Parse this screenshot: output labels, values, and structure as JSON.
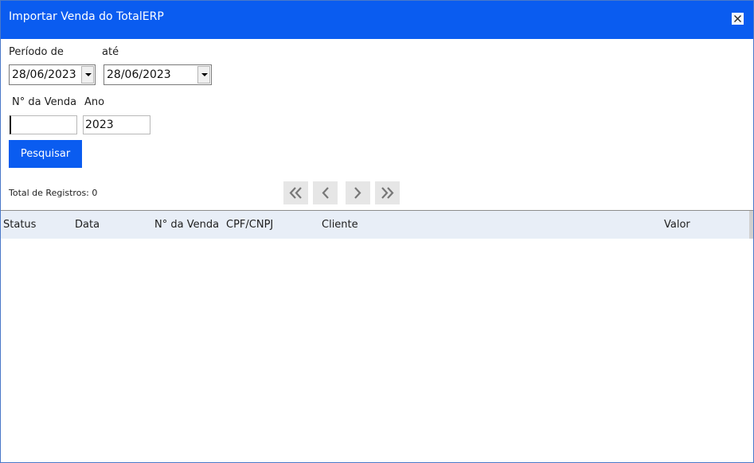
{
  "window": {
    "title": "Importar Venda do TotalERP",
    "accent_color": "#0a5cf0",
    "close_icon": "close-x-icon"
  },
  "filters": {
    "period_from_label": "Período de",
    "period_from_value": "28/06/2023",
    "period_to_label": "até",
    "period_to_value": "28/06/2023",
    "sale_number_label": "N° da Venda",
    "sale_number_value": "",
    "year_label": "Ano",
    "year_value": "2023"
  },
  "actions": {
    "search_label": "Pesquisar"
  },
  "pagination": {
    "total_records_text": "Total de Registros: 0",
    "icons": [
      "first-page-icon",
      "previous-page-icon",
      "next-page-icon",
      "last-page-icon"
    ]
  },
  "grid": {
    "columns": [
      "Status",
      "Data",
      "N° da Venda",
      "CPF/CNPJ",
      "Cliente",
      "Valor"
    ],
    "rows": []
  }
}
